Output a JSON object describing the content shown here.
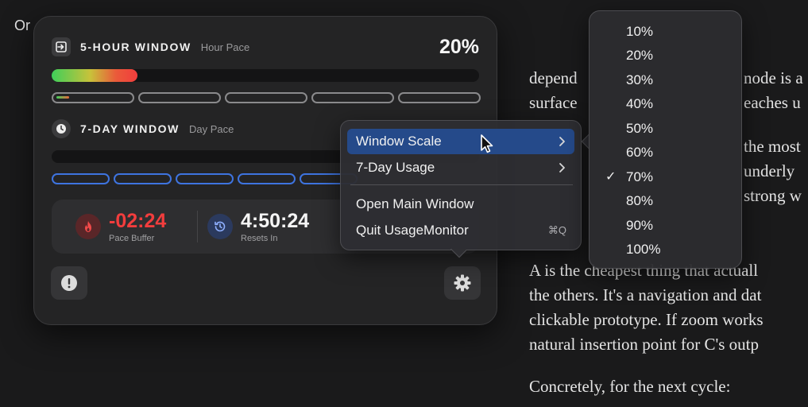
{
  "background": {
    "left_text": "Or",
    "doc_lines": [
      "depend",
      "surface",
      "A is the cheapest thing that actuall",
      "the others. It's a navigation and dat",
      "clickable prototype. If zoom works",
      "natural insertion point for C's outp",
      "Concretely, for the next cycle:"
    ],
    "doc_side_fragments": [
      "node is a",
      "eaches u",
      "the most",
      "underly",
      "strong w"
    ]
  },
  "widget": {
    "five_hour": {
      "title": "5-HOUR WINDOW",
      "subtitle": "Hour Pace",
      "percent_label": "20%",
      "usage_fraction": 0.2
    },
    "seven_day": {
      "title": "7-DAY WINDOW",
      "subtitle": "Day Pace"
    },
    "stats": {
      "pace_buffer_value": "-02:24",
      "pace_buffer_label": "Pace Buffer",
      "resets_in_value": "4:50:24",
      "resets_in_label": "Resets In"
    },
    "colors": {
      "accent_blue": "#3e74e0",
      "danger_red": "#f23d3d",
      "menu_highlight": "#254a8a"
    }
  },
  "menu": {
    "items": [
      {
        "label": "Window Scale",
        "highlighted": true,
        "has_submenu": true
      },
      {
        "label": "7-Day Usage",
        "has_submenu": true
      },
      {
        "label": "Open Main Window"
      },
      {
        "label": "Quit UsageMonitor",
        "shortcut": "⌘Q"
      }
    ]
  },
  "submenu": {
    "options": [
      "10%",
      "20%",
      "30%",
      "40%",
      "50%",
      "60%",
      "70%",
      "80%",
      "90%",
      "100%"
    ],
    "checkmark": "✓",
    "selected": "70%"
  }
}
